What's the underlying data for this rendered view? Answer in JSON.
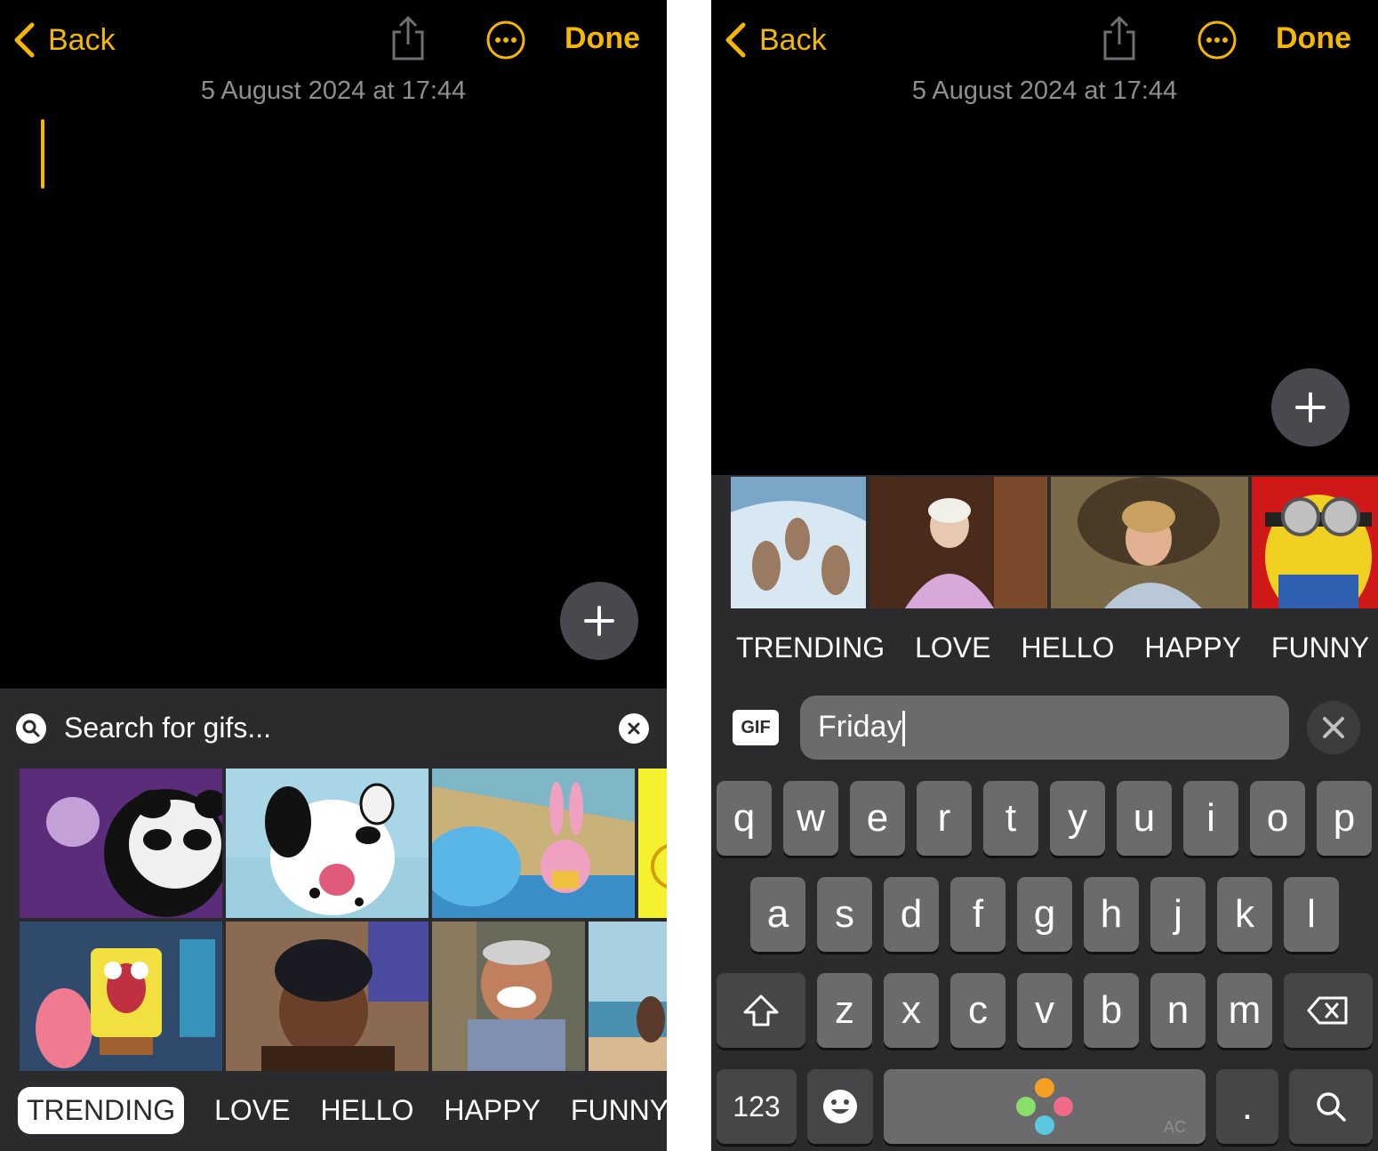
{
  "left": {
    "nav": {
      "back_label": "Back",
      "done_label": "Done"
    },
    "date": "5 August 2024 at 17:44",
    "search": {
      "placeholder": "Search for gifs..."
    },
    "categories": [
      {
        "label": "TRENDING",
        "active": true
      },
      {
        "label": "LOVE",
        "active": false
      },
      {
        "label": "HELLO",
        "active": false
      },
      {
        "label": "HAPPY",
        "active": false
      },
      {
        "label": "FUNNY",
        "active": false
      }
    ]
  },
  "right": {
    "nav": {
      "back_label": "Back",
      "done_label": "Done"
    },
    "date": "5 August 2024 at 17:44",
    "gif_badge": "GIF",
    "search_value": "Friday",
    "categories": [
      "TRENDING",
      "LOVE",
      "HELLO",
      "HAPPY",
      "FUNNY"
    ],
    "keyboard": {
      "row1": [
        "q",
        "w",
        "e",
        "r",
        "t",
        "y",
        "u",
        "i",
        "o",
        "p"
      ],
      "row2": [
        "a",
        "s",
        "d",
        "f",
        "g",
        "h",
        "j",
        "k",
        "l"
      ],
      "row3": [
        "z",
        "x",
        "c",
        "v",
        "b",
        "n",
        "m"
      ],
      "numbers_key": "123",
      "period_key": ".",
      "space_corner": "AC"
    }
  },
  "colors": {
    "accent": "#f5b700",
    "panel": "#2b2b2d",
    "key": "#6b6b6d"
  }
}
